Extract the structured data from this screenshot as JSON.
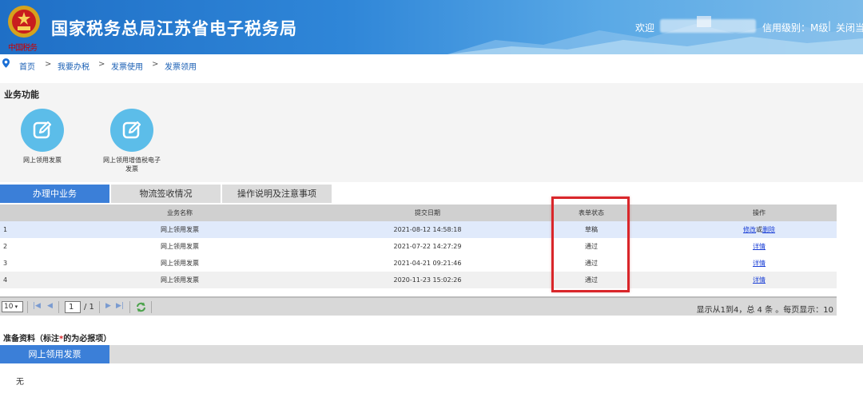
{
  "header": {
    "site_title": "国家税务总局江苏省电子税务局",
    "emblem_text": "中国税务",
    "welcome": "欢迎",
    "level": "信用级别：M级",
    "separator": "|",
    "close": "关闭当"
  },
  "breadcrumb": [
    "首页",
    "我要办税",
    "发票使用",
    "发票领用"
  ],
  "breadcrumb_sep": ">",
  "functions": {
    "title": "业务功能",
    "items": [
      {
        "label": "网上领用发票"
      },
      {
        "label": "网上领用增值税电子发票"
      }
    ]
  },
  "tabs": [
    {
      "label": "办理中业务",
      "active": true
    },
    {
      "label": "物流签收情况",
      "active": false
    },
    {
      "label": "操作说明及注意事项",
      "active": false
    }
  ],
  "table": {
    "headers": {
      "name": "业务名称",
      "date": "提交日期",
      "status": "表单状态",
      "op": "操作"
    },
    "rows": [
      {
        "idx": "1",
        "name": "网上领用发票",
        "date": "2021-08-12 14:58:18",
        "status": "草稿",
        "op1": "修改",
        "op_join": "或",
        "op2": "删除"
      },
      {
        "idx": "2",
        "name": "网上领用发票",
        "date": "2021-07-22 14:27:29",
        "status": "通过",
        "op1": "详情"
      },
      {
        "idx": "3",
        "name": "网上领用发票",
        "date": "2021-04-21 09:21:46",
        "status": "通过",
        "op1": "详情"
      },
      {
        "idx": "4",
        "name": "网上领用发票",
        "date": "2020-11-23 15:02:26",
        "status": "通过",
        "op1": "详情"
      }
    ]
  },
  "pager": {
    "page_size": "10",
    "current_page": "1",
    "total_pages": "/ 1",
    "info": "显示从1到4，总 4 条 。每页显示：10"
  },
  "prep": {
    "title_prefix": "准备资料（标注",
    "title_star": "*",
    "title_suffix": "的为必报项）",
    "tab": "网上领用发票",
    "content": "无"
  },
  "colors": {
    "accent": "#3b7fd8",
    "icon_circle": "#5cbde9",
    "highlight_box": "#d9262a",
    "link": "#1a3fd6"
  }
}
